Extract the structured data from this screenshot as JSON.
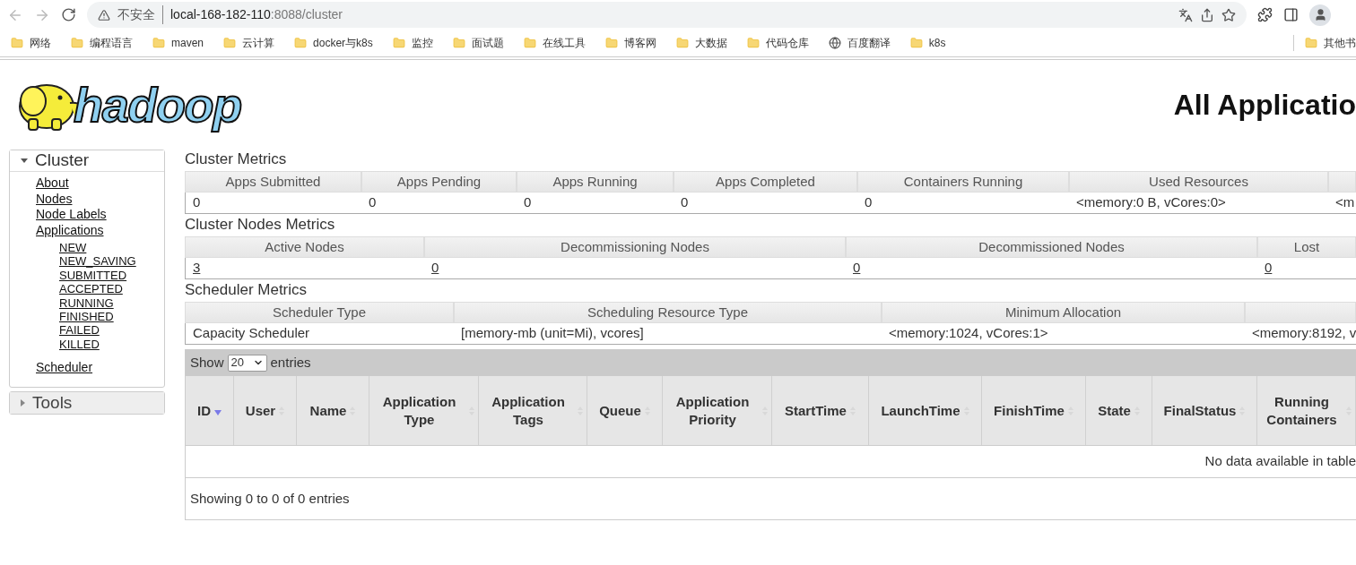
{
  "browser": {
    "security_label": "不安全",
    "url_host": "local-168-182-110",
    "url_path": ":8088/cluster"
  },
  "bookmarks": [
    {
      "label": "网络",
      "kind": "folder"
    },
    {
      "label": "编程语言",
      "kind": "folder"
    },
    {
      "label": "maven",
      "kind": "folder"
    },
    {
      "label": "云计算",
      "kind": "folder"
    },
    {
      "label": "docker与k8s",
      "kind": "folder"
    },
    {
      "label": "监控",
      "kind": "folder"
    },
    {
      "label": "面试题",
      "kind": "folder"
    },
    {
      "label": "在线工具",
      "kind": "folder"
    },
    {
      "label": "博客网",
      "kind": "folder"
    },
    {
      "label": "大数据",
      "kind": "folder"
    },
    {
      "label": "代码仓库",
      "kind": "folder"
    },
    {
      "label": "百度翻译",
      "kind": "site"
    },
    {
      "label": "k8s",
      "kind": "folder"
    }
  ],
  "bookmarks_overflow": "其他书",
  "logo": {
    "text": "hadoop"
  },
  "page_title": "All Applicatio",
  "sidebar": [
    {
      "label": "Cluster",
      "expanded": true,
      "items": [
        {
          "label": "About"
        },
        {
          "label": "Nodes"
        },
        {
          "label": "Node Labels"
        },
        {
          "label": "Applications",
          "children": [
            {
              "label": "NEW"
            },
            {
              "label": "NEW_SAVING"
            },
            {
              "label": "SUBMITTED"
            },
            {
              "label": "ACCEPTED"
            },
            {
              "label": "RUNNING"
            },
            {
              "label": "FINISHED"
            },
            {
              "label": "FAILED"
            },
            {
              "label": "KILLED"
            }
          ]
        },
        {
          "label": "Scheduler"
        }
      ]
    },
    {
      "label": "Tools",
      "expanded": false
    }
  ],
  "metrics": [
    {
      "title": "Cluster Metrics",
      "links": false,
      "columns": [
        {
          "header": "Apps Submitted",
          "value": "0"
        },
        {
          "header": "Apps Pending",
          "value": "0"
        },
        {
          "header": "Apps Running",
          "value": "0"
        },
        {
          "header": "Apps Completed",
          "value": "0"
        },
        {
          "header": "Containers Running",
          "value": "0"
        },
        {
          "header": "Used Resources",
          "value": "<memory:0 B, vCores:0>"
        },
        {
          "value": "<m"
        }
      ]
    },
    {
      "title": "Cluster Nodes Metrics",
      "links": true,
      "columns": [
        {
          "header": "Active Nodes",
          "value": "3"
        },
        {
          "header": "Decommissioning Nodes",
          "value": "0"
        },
        {
          "header": "Decommissioned Nodes",
          "value": "0"
        },
        {
          "header": "Lost",
          "value": "0"
        }
      ]
    },
    {
      "title": "Scheduler Metrics",
      "links": false,
      "columns": [
        {
          "header": "Scheduler Type",
          "value": "Capacity Scheduler"
        },
        {
          "header": "Scheduling Resource Type",
          "value": "[memory-mb (unit=Mi), vcores]"
        },
        {
          "header": "Minimum Allocation",
          "value": "<memory:1024, vCores:1>"
        },
        {
          "value": "<memory:8192, v"
        }
      ]
    }
  ],
  "apps_table": {
    "show_label": "Show",
    "page_size": "20",
    "entries_label": "entries",
    "columns": [
      {
        "label": "ID",
        "sorted": true
      },
      {
        "label": "User",
        "sorted": false
      },
      {
        "label": "Name",
        "sorted": false
      },
      {
        "label": "Application Type",
        "sorted": false
      },
      {
        "label": "Application Tags",
        "sorted": false
      },
      {
        "label": "Queue",
        "sorted": false
      },
      {
        "label": "Application Priority",
        "sorted": false
      },
      {
        "label": "StartTime",
        "sorted": false
      },
      {
        "label": "LaunchTime",
        "sorted": false
      },
      {
        "label": "FinishTime",
        "sorted": false
      },
      {
        "label": "State",
        "sorted": false
      },
      {
        "label": "FinalStatus",
        "sorted": false
      },
      {
        "label": "Running Containers",
        "sorted": false
      }
    ],
    "empty_message": "No data available in table",
    "footer": "Showing 0 to 0 of 0 entries"
  }
}
